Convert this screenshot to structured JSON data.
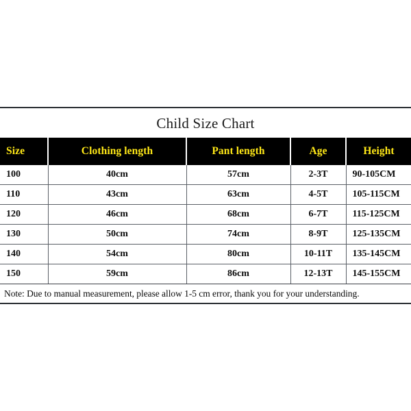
{
  "chart_data": {
    "type": "table",
    "title": "Child Size Chart",
    "columns": [
      "Size",
      "Clothing length",
      "Pant length",
      "Age",
      "Height"
    ],
    "rows": [
      [
        "100",
        "40cm",
        "57cm",
        "2-3T",
        "90-105CM"
      ],
      [
        "110",
        "43cm",
        "63cm",
        "4-5T",
        "105-115CM"
      ],
      [
        "120",
        "46cm",
        "68cm",
        "6-7T",
        "115-125CM"
      ],
      [
        "130",
        "50cm",
        "74cm",
        "8-9T",
        "125-135CM"
      ],
      [
        "140",
        "54cm",
        "80cm",
        "10-11T",
        "135-145CM"
      ],
      [
        "150",
        "59cm",
        "86cm",
        "12-13T",
        "145-155CM"
      ]
    ],
    "note": "Note: Due to manual measurement, please allow 1-5 cm error, thank you for your understanding.",
    "colors": {
      "header_background": "#000000",
      "header_text": "#FFE817",
      "body_text": "#0B0B0B",
      "page_background": "#FFFFFF",
      "grid_line": "#5A5F66"
    }
  }
}
